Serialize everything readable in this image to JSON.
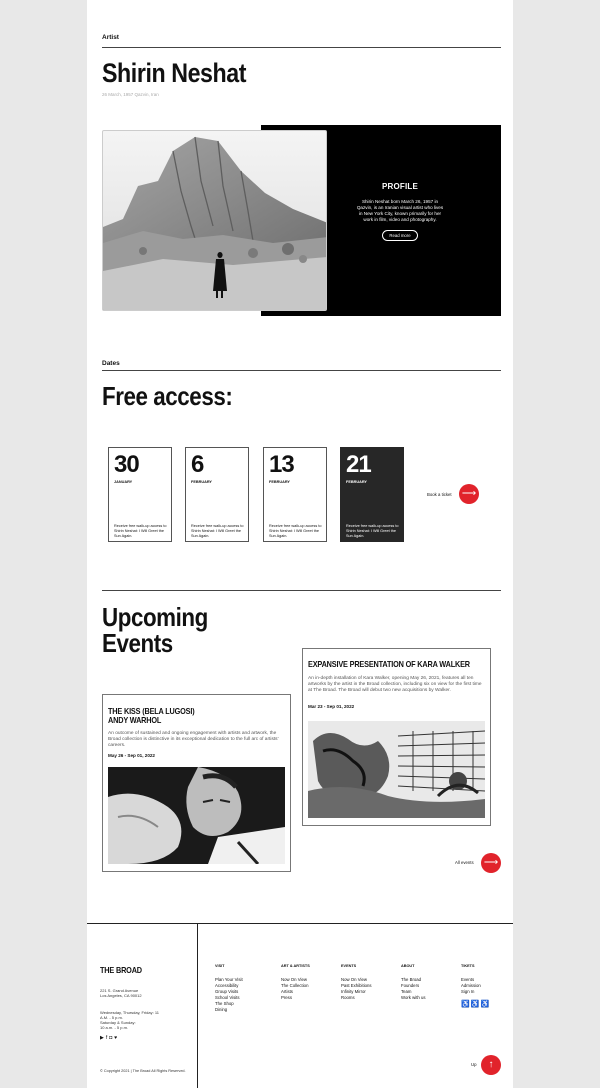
{
  "artist": {
    "section_label": "Artist",
    "name": "Shirin Neshat",
    "birth": "26 March, 1957 Qazvin, Iran"
  },
  "profile": {
    "title": "PROFILE",
    "text": "Shirin Neshat born March 26, 1957 in Qazvin, is an Iranian visual artist who lives in New York City, known primarily for her work in film, video and photography.",
    "read_more": "Read more"
  },
  "dates": {
    "section_label": "Dates",
    "title": "Free access:",
    "cards": [
      {
        "day": "30",
        "month": "JANUARY",
        "desc": "Receive free walk-up access to Shirin Neshat: I Will Greet the Sun Again."
      },
      {
        "day": "6",
        "month": "FEBRUARY",
        "desc": "Receive free walk-up access to Shirin Neshat: I Will Greet the Sun Again."
      },
      {
        "day": "13",
        "month": "FEBRUARY",
        "desc": "Receive free walk-up access to Shirin Neshat: I Will Greet the Sun Again."
      },
      {
        "day": "21",
        "month": "FEBRUARY",
        "desc": "Receive free walk-up access to Shirin Neshat: I Will Greet the Sun Again."
      }
    ],
    "book_label": "Book a ticket",
    "book_icon": "arrow-right-icon"
  },
  "events": {
    "title_line1": "Upcoming",
    "title_line2": "Events",
    "kara": {
      "title": "EXPANSIVE PRESENTATION OF KARA WALKER",
      "desc": "An in-depth installation of Kara Walker, opening May 26, 2021, features all ten artworks by the artist in the Broad collection, including six on view for the first time at The Broad. The Broad will debut two new acquisitions by Walker.",
      "date": "Mar 23 - Sep 01, 2022"
    },
    "warhol": {
      "title_line1": "THE KISS (BELA LUGOSI)",
      "title_line2": "ANDY WARHOL",
      "desc": "An outcome of sustained and ongoing engagement with artists and artwork, the Broad collection is distinctive in its exceptional dedication to the full arc of artists' careers.",
      "date": "May 26 - Sep 01, 2022"
    },
    "all_events": "All events"
  },
  "footer": {
    "brand": "THE BROAD",
    "address_line1": "221 S. Grand Avenue",
    "address_line2": "Los Angeles, CA 90012",
    "hours_line1": "Wednesday, Thursday, Friday: 11",
    "hours_line2": "A.M. - 5 p.m.",
    "hours_line3": "Saturday & Sunday:",
    "hours_line4": "10 a.m. - 5 p.m.",
    "social_icons": [
      "youtube-icon",
      "facebook-icon",
      "instagram-icon",
      "twitter-icon"
    ],
    "copyright": "© Copyright 2021 | The Broad All Rights Reserved.",
    "up_label": "Up",
    "columns": [
      {
        "head": "VISIT",
        "items": [
          "Plan Your Visit",
          "Accessibility",
          "Group Visits",
          "School Visits",
          "The Shop",
          "Dining"
        ]
      },
      {
        "head": "ART & ARTISTS",
        "items": [
          "Now On View",
          "The Collection",
          "Artists",
          "Press"
        ]
      },
      {
        "head": "EVENTS",
        "items": [
          "Now On View",
          "Past Exhibitions",
          "Infinity Mirror",
          "Rooms"
        ]
      },
      {
        "head": "ABOUT",
        "items": [
          "The Broad",
          "Founders",
          "Team",
          "Work with us"
        ]
      },
      {
        "head": "TIKETS",
        "items": [
          "Events",
          "Admission",
          "Sign In"
        ]
      }
    ],
    "access_icons": [
      "wheelchair-icon",
      "audio-description-icon",
      "hearing-assistance-icon"
    ]
  },
  "colors": {
    "accent": "#e1232b",
    "dark_card": "#272727"
  }
}
